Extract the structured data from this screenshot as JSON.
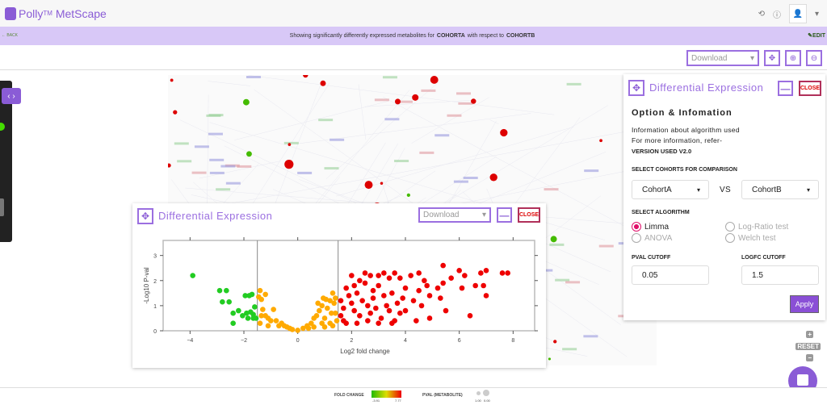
{
  "app": {
    "brand": "Polly",
    "brand_tm": "TM",
    "product": "MetScape"
  },
  "banner": {
    "back": "← BACK",
    "prefix": "Showing significantly differently expressed metabolites for",
    "cohort_a": "COHORTA",
    "middle": "with respect to",
    "cohort_b": "COHORTB",
    "edit": "EDIT"
  },
  "toolbar": {
    "download": "Download"
  },
  "options_panel": {
    "title": "Differential Expression",
    "minimize": "—",
    "close": "CLOSE",
    "heading": "Option & Infomation",
    "info1": "Information about algorithm used",
    "info2": "For more information, refer-",
    "version": "VERSION USED V2.0",
    "cohorts_label": "SELECT COHORTS FOR COMPARISON",
    "cohort_a": "CohortA",
    "vs": "VS",
    "cohort_b": "CohortB",
    "algorithm_label": "SELECT ALGORITHM",
    "algorithms": [
      {
        "label": "Limma",
        "selected": true
      },
      {
        "label": "Log-Ratio test",
        "selected": false
      },
      {
        "label": "ANOVA",
        "selected": false
      },
      {
        "label": "Welch test",
        "selected": false
      }
    ],
    "pval_label": "PVAL CUTOFF",
    "pval": "0.05",
    "logfc_label": "LOGFC CUTOFF",
    "logfc": "1.5",
    "apply": "Apply"
  },
  "plot_panel": {
    "title": "Differential Expression",
    "download": "Download",
    "minimize": "—",
    "close": "CLOSE"
  },
  "zoom_controls": {
    "plus": "+",
    "reset": "RESET",
    "minus": "−"
  },
  "legend": {
    "fold_change": "FOLD CHANGE",
    "fc_min": "-3.91",
    "fc_max": "7.77",
    "pval": "PVAL (METABOLITE)",
    "pval_min": "1.00",
    "pval_max": "0.00"
  },
  "chart_data": {
    "type": "scatter",
    "xlabel": "Log2 fold change",
    "ylabel": "-Log10 P-val",
    "xlim": [
      -5,
      8.8
    ],
    "ylim": [
      0,
      3.6
    ],
    "xticks": [
      -4,
      -2,
      0,
      2,
      4,
      6,
      8
    ],
    "yticks": [
      0,
      1,
      2,
      3
    ],
    "thresholds_x": [
      -1.5,
      1.5
    ],
    "colors": {
      "down": "#22cc22",
      "ns": "#ffaa00",
      "up": "#ee0000"
    },
    "series": [
      {
        "group": "down",
        "points": [
          [
            -3.9,
            2.2
          ],
          [
            -2.9,
            1.6
          ],
          [
            -2.65,
            1.6
          ],
          [
            -2.8,
            1.15
          ],
          [
            -2.55,
            1.15
          ],
          [
            -2.4,
            0.7
          ],
          [
            -2.2,
            0.8
          ],
          [
            -2.4,
            0.3
          ],
          [
            -2.05,
            0.6
          ],
          [
            -1.95,
            1.4
          ],
          [
            -1.8,
            1.4
          ],
          [
            -1.7,
            1.45
          ],
          [
            -1.9,
            0.7
          ],
          [
            -1.75,
            0.75
          ],
          [
            -1.85,
            0.5
          ],
          [
            -1.65,
            0.65
          ],
          [
            -1.6,
            0.95
          ],
          [
            -1.65,
            0.5
          ],
          [
            -1.55,
            0.5
          ]
        ]
      },
      {
        "group": "ns",
        "points": [
          [
            -1.4,
            1.6
          ],
          [
            -1.35,
            1.25
          ],
          [
            -1.45,
            1.35
          ],
          [
            -1.2,
            1.45
          ],
          [
            -1.3,
            0.85
          ],
          [
            -1.35,
            0.6
          ],
          [
            -1.2,
            0.6
          ],
          [
            -1.1,
            0.5
          ],
          [
            -0.9,
            0.85
          ],
          [
            -1.0,
            0.4
          ],
          [
            -0.8,
            0.4
          ],
          [
            -0.6,
            0.3
          ],
          [
            -0.5,
            0.2
          ],
          [
            -0.7,
            0.2
          ],
          [
            -0.3,
            0.1
          ],
          [
            -0.2,
            0.05
          ],
          [
            0,
            0.02
          ],
          [
            0.2,
            0.1
          ],
          [
            0.35,
            0.2
          ],
          [
            0.5,
            0.3
          ],
          [
            0.6,
            0.5
          ],
          [
            0.7,
            0.6
          ],
          [
            0.8,
            0.8
          ],
          [
            0.9,
            1.0
          ],
          [
            0.95,
            1.3
          ],
          [
            1.0,
            0.5
          ],
          [
            1.1,
            0.9
          ],
          [
            1.2,
            1.2
          ],
          [
            1.3,
            1.5
          ],
          [
            1.35,
            1.1
          ],
          [
            1.4,
            0.7
          ],
          [
            1.45,
            0.4
          ],
          [
            1.2,
            0.3
          ],
          [
            0.9,
            0.3
          ],
          [
            1.05,
            1.25
          ],
          [
            0.75,
            1.1
          ],
          [
            1.25,
            0.7
          ],
          [
            0.4,
            0.1
          ],
          [
            -0.4,
            0.15
          ],
          [
            1.4,
            1.3
          ],
          [
            -1.4,
            0.3
          ],
          [
            -1.1,
            0.2
          ],
          [
            0.6,
            0.15
          ],
          [
            1.0,
            0.15
          ],
          [
            1.3,
            0.2
          ]
        ]
      },
      {
        "group": "up",
        "points": [
          [
            1.6,
            1.2
          ],
          [
            1.7,
            0.9
          ],
          [
            1.6,
            0.6
          ],
          [
            1.8,
            1.7
          ],
          [
            1.9,
            1.4
          ],
          [
            1.8,
            0.3
          ],
          [
            2.0,
            2.2
          ],
          [
            2.0,
            1.1
          ],
          [
            2.1,
            0.8
          ],
          [
            2.1,
            1.8
          ],
          [
            2.2,
            1.5
          ],
          [
            2.3,
            2.0
          ],
          [
            2.3,
            0.6
          ],
          [
            2.4,
            1.2
          ],
          [
            2.5,
            2.3
          ],
          [
            2.5,
            1.9
          ],
          [
            2.6,
            1.0
          ],
          [
            2.7,
            2.2
          ],
          [
            2.7,
            0.7
          ],
          [
            2.8,
            1.6
          ],
          [
            2.8,
            1.3
          ],
          [
            2.9,
            0.9
          ],
          [
            3.0,
            2.2
          ],
          [
            3.0,
            1.8
          ],
          [
            3.1,
            0.5
          ],
          [
            3.2,
            2.3
          ],
          [
            3.2,
            1.4
          ],
          [
            3.3,
            1.0
          ],
          [
            3.4,
            2.1
          ],
          [
            3.4,
            0.8
          ],
          [
            3.5,
            1.5
          ],
          [
            3.6,
            2.3
          ],
          [
            3.6,
            0.4
          ],
          [
            3.7,
            1.1
          ],
          [
            3.8,
            2.1
          ],
          [
            3.8,
            0.7
          ],
          [
            3.9,
            1.3
          ],
          [
            4.0,
            0.8
          ],
          [
            4.0,
            1.7
          ],
          [
            4.2,
            2.2
          ],
          [
            4.3,
            1.2
          ],
          [
            4.4,
            0.4
          ],
          [
            4.5,
            2.3
          ],
          [
            4.5,
            1.6
          ],
          [
            4.6,
            1.0
          ],
          [
            4.7,
            2.0
          ],
          [
            4.8,
            1.8
          ],
          [
            4.9,
            1.4
          ],
          [
            4.9,
            0.5
          ],
          [
            5.2,
            1.7
          ],
          [
            5.3,
            1.3
          ],
          [
            5.4,
            1.9
          ],
          [
            5.4,
            2.6
          ],
          [
            5.5,
            0.8
          ],
          [
            5.7,
            2.1
          ],
          [
            6.0,
            2.4
          ],
          [
            6.1,
            1.7
          ],
          [
            6.2,
            2.2
          ],
          [
            6.4,
            0.6
          ],
          [
            6.6,
            1.8
          ],
          [
            6.8,
            2.3
          ],
          [
            6.9,
            1.8
          ],
          [
            7.0,
            2.4
          ],
          [
            7.0,
            1.4
          ],
          [
            7.6,
            2.3
          ],
          [
            7.8,
            2.3
          ],
          [
            1.7,
            0.4
          ],
          [
            2.2,
            0.3
          ],
          [
            2.6,
            0.4
          ],
          [
            3.0,
            0.3
          ],
          [
            3.5,
            0.3
          ]
        ]
      }
    ]
  }
}
